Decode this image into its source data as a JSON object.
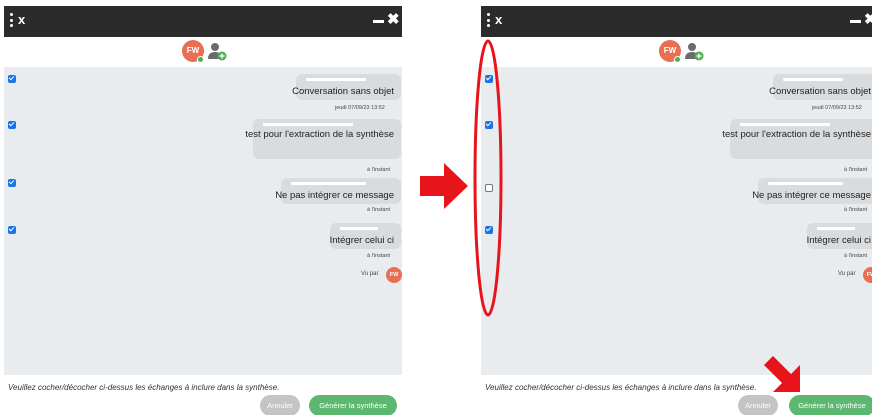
{
  "window": {
    "title_glyph": "x"
  },
  "avatar": {
    "initials": "FW"
  },
  "messages": [
    {
      "text": "Conversation sans objet",
      "timestamp": "jeudi 07/09/23 13:52"
    },
    {
      "text": "test pour l'extraction de la synthèse",
      "timestamp": "à l'instant"
    },
    {
      "text": "Ne pas intégrer ce message",
      "timestamp": "à l'instant"
    },
    {
      "text": "Intégrer celui ci",
      "timestamp": "à l'instant"
    }
  ],
  "seen_by": {
    "label": "Vu par",
    "initials": "FW"
  },
  "footer": {
    "instruction": "Veuillez cocher/décocher ci-dessus les échanges à inclure dans la synthèse.",
    "cancel_label": "Annuler",
    "generate_label": "Générer la synthèse"
  },
  "checkbox_states": {
    "before": [
      true,
      true,
      true,
      true
    ],
    "after": [
      true,
      true,
      false,
      true
    ]
  },
  "colors": {
    "titlebar": "#2b2b2b",
    "chat_background": "#e9ecef",
    "bubble": "#d9dcdf",
    "avatar": "#e86f51",
    "generate_button": "#5cb870",
    "cancel_button": "#c4c4c4",
    "checkbox_checked": "#1a73e8",
    "annotation": "#e8141c"
  }
}
